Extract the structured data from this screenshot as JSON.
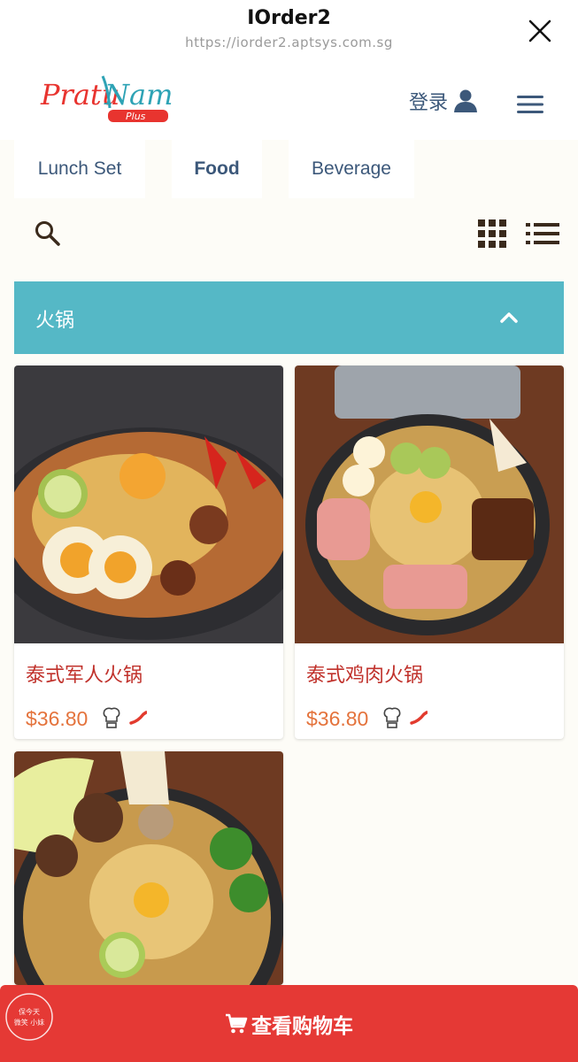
{
  "browser": {
    "title": "IOrder2",
    "url": "https://iorder2.aptsys.com.sg"
  },
  "header": {
    "logo_text": "PratuNam",
    "logo_sub": "Plus",
    "login_label": "登录"
  },
  "tabs": [
    {
      "label": "Lunch Set",
      "active": false
    },
    {
      "label": "Food",
      "active": true
    },
    {
      "label": "Beverage",
      "active": false
    }
  ],
  "category": {
    "title": "火锅",
    "expanded": true
  },
  "products": [
    {
      "name": "泰式军人火锅",
      "price": "$36.80",
      "icons": [
        "chef-icon",
        "chili-icon"
      ]
    },
    {
      "name": "泰式鸡肉火锅",
      "price": "$36.80",
      "icons": [
        "chef-icon",
        "chili-icon"
      ]
    },
    {
      "name": "",
      "price": "",
      "icons": []
    }
  ],
  "cart": {
    "label": "查看购物车"
  },
  "watermark_text": "保今天 微笑 小妹",
  "colors": {
    "category_bar": "#55b8c6",
    "cart_bar": "#e53935",
    "product_name": "#c0312b",
    "price": "#e4733c",
    "tab_text": "#3c587a"
  }
}
